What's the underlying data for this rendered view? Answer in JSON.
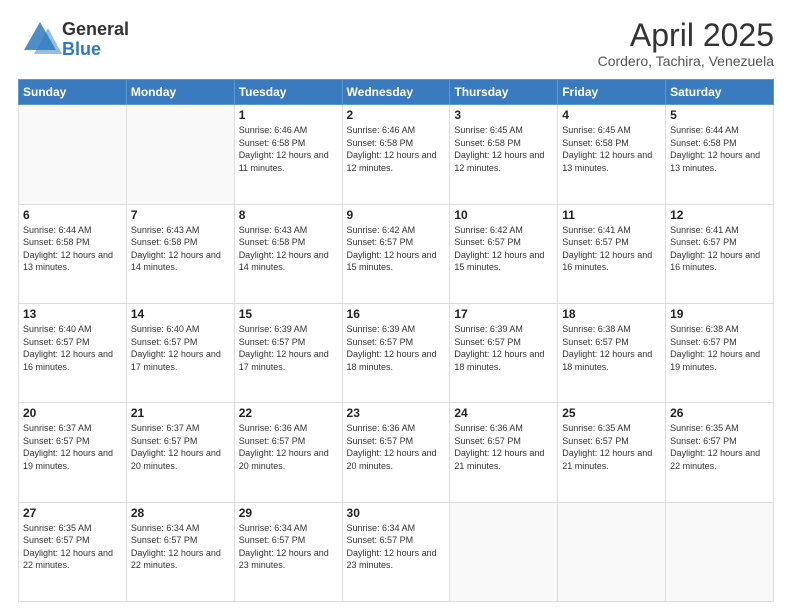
{
  "logo": {
    "general": "General",
    "blue": "Blue"
  },
  "header": {
    "month": "April 2025",
    "location": "Cordero, Tachira, Venezuela"
  },
  "weekdays": [
    "Sunday",
    "Monday",
    "Tuesday",
    "Wednesday",
    "Thursday",
    "Friday",
    "Saturday"
  ],
  "weeks": [
    [
      {
        "day": "",
        "info": ""
      },
      {
        "day": "",
        "info": ""
      },
      {
        "day": "1",
        "info": "Sunrise: 6:46 AM\nSunset: 6:58 PM\nDaylight: 12 hours and 11 minutes."
      },
      {
        "day": "2",
        "info": "Sunrise: 6:46 AM\nSunset: 6:58 PM\nDaylight: 12 hours and 12 minutes."
      },
      {
        "day": "3",
        "info": "Sunrise: 6:45 AM\nSunset: 6:58 PM\nDaylight: 12 hours and 12 minutes."
      },
      {
        "day": "4",
        "info": "Sunrise: 6:45 AM\nSunset: 6:58 PM\nDaylight: 12 hours and 13 minutes."
      },
      {
        "day": "5",
        "info": "Sunrise: 6:44 AM\nSunset: 6:58 PM\nDaylight: 12 hours and 13 minutes."
      }
    ],
    [
      {
        "day": "6",
        "info": "Sunrise: 6:44 AM\nSunset: 6:58 PM\nDaylight: 12 hours and 13 minutes."
      },
      {
        "day": "7",
        "info": "Sunrise: 6:43 AM\nSunset: 6:58 PM\nDaylight: 12 hours and 14 minutes."
      },
      {
        "day": "8",
        "info": "Sunrise: 6:43 AM\nSunset: 6:58 PM\nDaylight: 12 hours and 14 minutes."
      },
      {
        "day": "9",
        "info": "Sunrise: 6:42 AM\nSunset: 6:57 PM\nDaylight: 12 hours and 15 minutes."
      },
      {
        "day": "10",
        "info": "Sunrise: 6:42 AM\nSunset: 6:57 PM\nDaylight: 12 hours and 15 minutes."
      },
      {
        "day": "11",
        "info": "Sunrise: 6:41 AM\nSunset: 6:57 PM\nDaylight: 12 hours and 16 minutes."
      },
      {
        "day": "12",
        "info": "Sunrise: 6:41 AM\nSunset: 6:57 PM\nDaylight: 12 hours and 16 minutes."
      }
    ],
    [
      {
        "day": "13",
        "info": "Sunrise: 6:40 AM\nSunset: 6:57 PM\nDaylight: 12 hours and 16 minutes."
      },
      {
        "day": "14",
        "info": "Sunrise: 6:40 AM\nSunset: 6:57 PM\nDaylight: 12 hours and 17 minutes."
      },
      {
        "day": "15",
        "info": "Sunrise: 6:39 AM\nSunset: 6:57 PM\nDaylight: 12 hours and 17 minutes."
      },
      {
        "day": "16",
        "info": "Sunrise: 6:39 AM\nSunset: 6:57 PM\nDaylight: 12 hours and 18 minutes."
      },
      {
        "day": "17",
        "info": "Sunrise: 6:39 AM\nSunset: 6:57 PM\nDaylight: 12 hours and 18 minutes."
      },
      {
        "day": "18",
        "info": "Sunrise: 6:38 AM\nSunset: 6:57 PM\nDaylight: 12 hours and 18 minutes."
      },
      {
        "day": "19",
        "info": "Sunrise: 6:38 AM\nSunset: 6:57 PM\nDaylight: 12 hours and 19 minutes."
      }
    ],
    [
      {
        "day": "20",
        "info": "Sunrise: 6:37 AM\nSunset: 6:57 PM\nDaylight: 12 hours and 19 minutes."
      },
      {
        "day": "21",
        "info": "Sunrise: 6:37 AM\nSunset: 6:57 PM\nDaylight: 12 hours and 20 minutes."
      },
      {
        "day": "22",
        "info": "Sunrise: 6:36 AM\nSunset: 6:57 PM\nDaylight: 12 hours and 20 minutes."
      },
      {
        "day": "23",
        "info": "Sunrise: 6:36 AM\nSunset: 6:57 PM\nDaylight: 12 hours and 20 minutes."
      },
      {
        "day": "24",
        "info": "Sunrise: 6:36 AM\nSunset: 6:57 PM\nDaylight: 12 hours and 21 minutes."
      },
      {
        "day": "25",
        "info": "Sunrise: 6:35 AM\nSunset: 6:57 PM\nDaylight: 12 hours and 21 minutes."
      },
      {
        "day": "26",
        "info": "Sunrise: 6:35 AM\nSunset: 6:57 PM\nDaylight: 12 hours and 22 minutes."
      }
    ],
    [
      {
        "day": "27",
        "info": "Sunrise: 6:35 AM\nSunset: 6:57 PM\nDaylight: 12 hours and 22 minutes."
      },
      {
        "day": "28",
        "info": "Sunrise: 6:34 AM\nSunset: 6:57 PM\nDaylight: 12 hours and 22 minutes."
      },
      {
        "day": "29",
        "info": "Sunrise: 6:34 AM\nSunset: 6:57 PM\nDaylight: 12 hours and 23 minutes."
      },
      {
        "day": "30",
        "info": "Sunrise: 6:34 AM\nSunset: 6:57 PM\nDaylight: 12 hours and 23 minutes."
      },
      {
        "day": "",
        "info": ""
      },
      {
        "day": "",
        "info": ""
      },
      {
        "day": "",
        "info": ""
      }
    ]
  ]
}
